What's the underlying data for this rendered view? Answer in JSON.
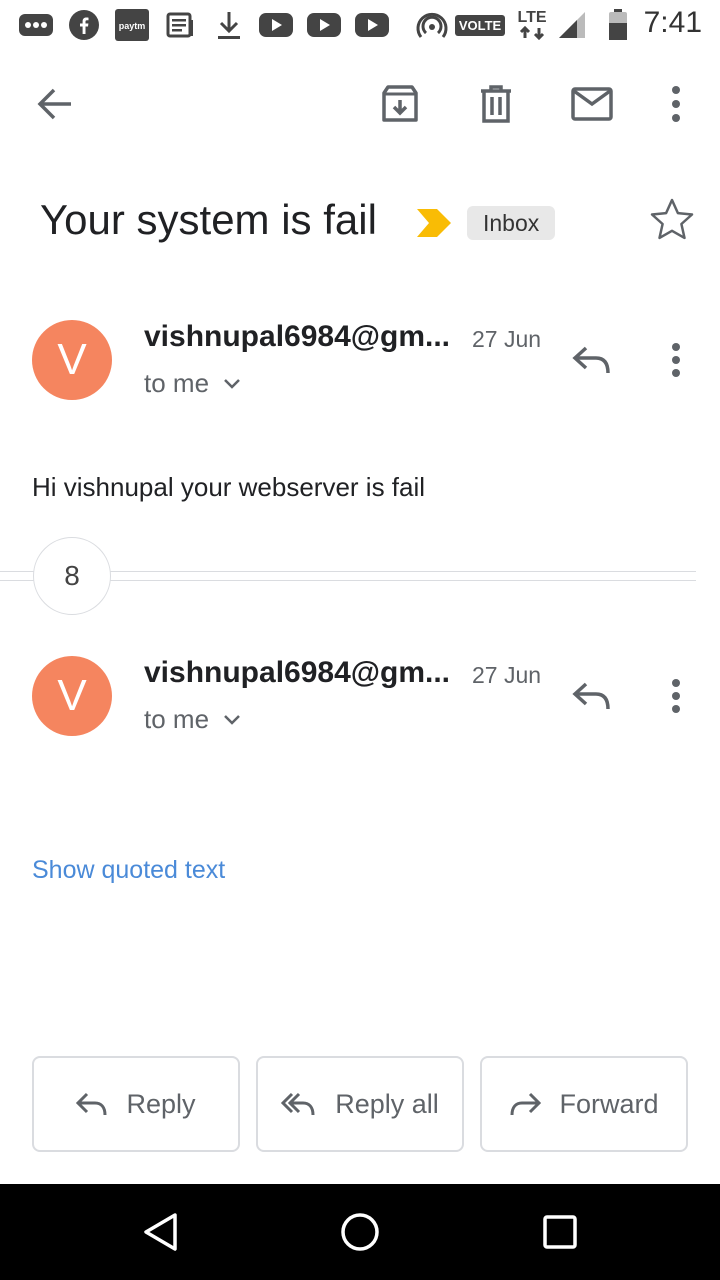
{
  "status_bar": {
    "time": "7:41",
    "network_badge": "VOLTE",
    "lte_label": "LTE",
    "paytm_label": "paytm",
    "icons": [
      "messages-icon",
      "facebook-icon",
      "paytm-icon",
      "news-icon",
      "download-icon",
      "youtube-icon",
      "youtube-icon",
      "youtube-icon",
      "hotspot-icon",
      "volte-icon",
      "lte-icon",
      "signal-icon",
      "battery-icon"
    ]
  },
  "toolbar": {
    "icons": [
      "back-arrow-icon",
      "archive-icon",
      "delete-icon",
      "mark-unread-icon",
      "more-vert-icon"
    ]
  },
  "thread": {
    "subject": "Your system is fail",
    "label_chip": "Inbox",
    "important_color": "#f9bc05"
  },
  "messages": [
    {
      "avatar_letter": "V",
      "avatar_color": "#f5855f",
      "sender": "vishnupal6984@gm...",
      "date": "27 Jun",
      "recipient": "to me",
      "body": "Hi vishnupal your webserver is fail"
    },
    {
      "avatar_letter": "V",
      "avatar_color": "#f5855f",
      "sender": "vishnupal6984@gm...",
      "date": "27 Jun",
      "recipient": "to me"
    }
  ],
  "collapsed_count": "8",
  "show_quoted_text": "Show quoted text",
  "actions": {
    "reply": "Reply",
    "reply_all": "Reply all",
    "forward": "Forward"
  },
  "nav": {
    "icons": [
      "back-triangle-icon",
      "home-circle-icon",
      "recents-square-icon"
    ]
  },
  "colors": {
    "link": "#4a8ad8",
    "chip_bg": "#e8e8e8"
  }
}
